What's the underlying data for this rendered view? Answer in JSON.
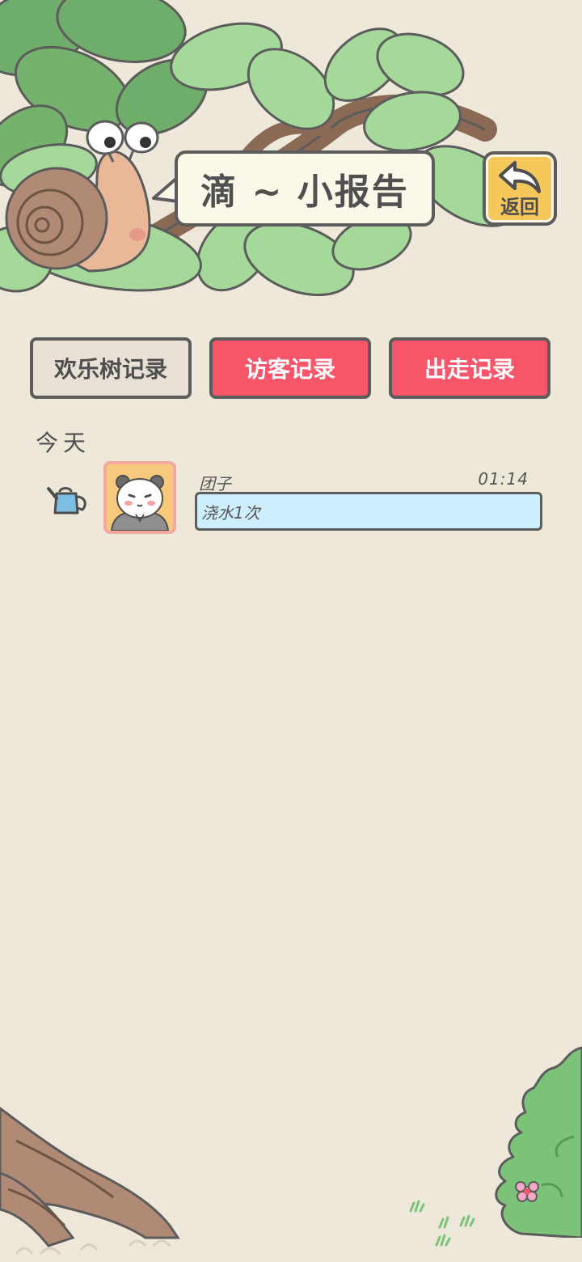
{
  "header": {
    "title": "滴 ~ 小报告",
    "back_label": "返回"
  },
  "tabs": [
    {
      "label": "欢乐树记录",
      "active": false
    },
    {
      "label": "访客记录",
      "active": true
    },
    {
      "label": "出走记录",
      "active": true
    }
  ],
  "section": {
    "label": "今天"
  },
  "records": [
    {
      "icon": "watering-can-icon",
      "avatar": "panda-avatar",
      "name": "团子",
      "time": "01:14",
      "action": "浇水1次"
    }
  ],
  "colors": {
    "background": "#ede8da",
    "tab_active": "#f6556a",
    "tab_inactive": "#e9e1d5",
    "back_button": "#f6c85c",
    "record_bar": "#cdeefd",
    "outline": "#5c5c5c"
  }
}
